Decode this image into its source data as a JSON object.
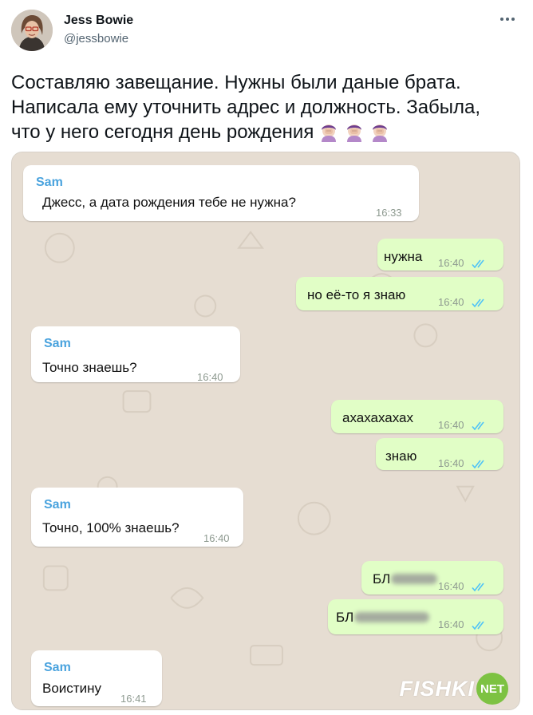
{
  "author": {
    "display_name": "Jess Bowie",
    "handle": "@jessbowie"
  },
  "tweet": {
    "text": "Составляю завещание. Нужны были даные брата.\nНаписала ему уточнить адрес и должность. Забыла,\nчто у него сегодня день рождения",
    "trailing_emoji": [
      "facepalm-emoji",
      "facepalm-emoji",
      "facepalm-emoji"
    ]
  },
  "chat": {
    "messages": [
      {
        "dir": "in",
        "sender": "Sam",
        "text": "Джесс, а дата рождения тебе не нужна?",
        "time": "16:33"
      },
      {
        "dir": "out",
        "text": "нужна",
        "time": "16:40",
        "read": true
      },
      {
        "dir": "out",
        "text": "но её-то я знаю",
        "time": "16:40",
        "read": true
      },
      {
        "dir": "in",
        "sender": "Sam",
        "text": "Точно знаешь?",
        "time": "16:40"
      },
      {
        "dir": "out",
        "text": "ахахахахах",
        "time": "16:40",
        "read": true
      },
      {
        "dir": "out",
        "text": "знаю",
        "time": "16:40",
        "read": true
      },
      {
        "dir": "in",
        "sender": "Sam",
        "text": "Точно, 100% знаешь?",
        "time": "16:40"
      },
      {
        "dir": "out",
        "text": "БЛ",
        "time": "16:40",
        "read": true,
        "censored": "short"
      },
      {
        "dir": "out",
        "text": "БЛ",
        "time": "16:40",
        "read": true,
        "censored": "long"
      },
      {
        "dir": "in",
        "sender": "Sam",
        "text": "Воистину",
        "time": "16:41"
      }
    ]
  },
  "watermark": {
    "brand": "FISHKI",
    "badge": "NET"
  },
  "colors": {
    "incoming": "#ffffff",
    "outgoing": "#e1fec6",
    "sender_name": "#4aa3de",
    "read_ticks": "#4fc3f7",
    "chat_bg": "#e7ddd2",
    "watermark_badge": "#7dc242"
  }
}
